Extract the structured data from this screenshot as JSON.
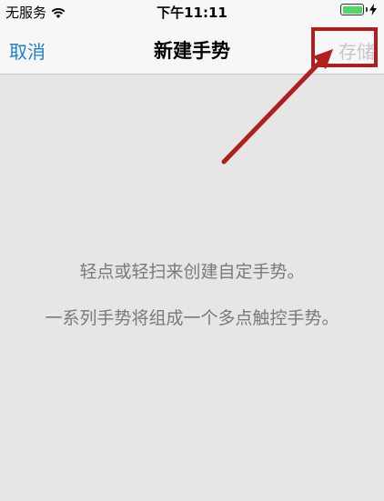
{
  "status_bar": {
    "carrier": "无服务",
    "time": "下午11:11",
    "battery_level": 1.0
  },
  "nav": {
    "cancel_label": "取消",
    "title": "新建手势",
    "save_label": "存储"
  },
  "content": {
    "hint_line_1": "轻点或轻扫来创建自定手势。",
    "hint_line_2": "一系列手势将组成一个多点触控手势。"
  },
  "colors": {
    "accent": "#1e7fd1",
    "disabled": "#c6c6c6",
    "annotation": "#b01e1e",
    "battery": "#4cd964"
  },
  "icons": [
    "wifi-icon",
    "battery-icon",
    "charging-bolt-icon"
  ]
}
